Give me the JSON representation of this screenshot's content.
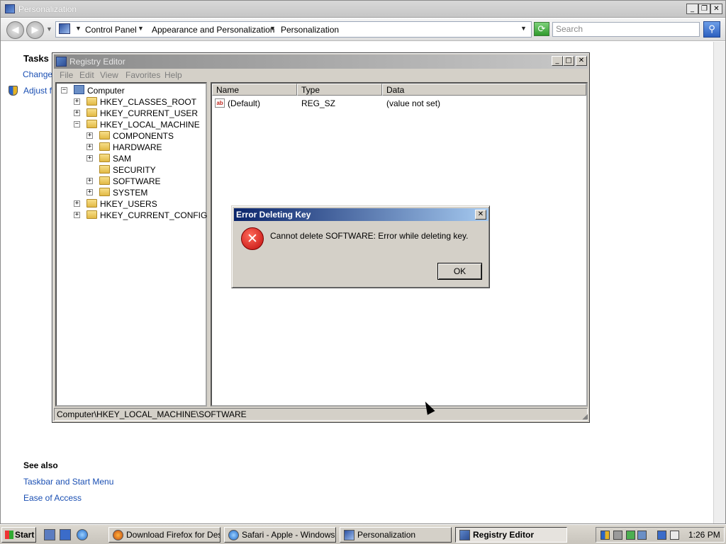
{
  "personalization": {
    "title": "Personalization",
    "breadcrumbs": [
      "Control Panel",
      "Appearance and Personalization",
      "Personalization"
    ],
    "search_placeholder": "Search",
    "tasks_title": "Tasks",
    "task_links": [
      "Change",
      "Adjust fo"
    ],
    "see_also_title": "See also",
    "see_also_links": [
      "Taskbar and Start Menu",
      "Ease of Access"
    ]
  },
  "regedit": {
    "title": "Registry Editor",
    "menu": [
      "File",
      "Edit",
      "View",
      "Favorites",
      "Help"
    ],
    "tree": {
      "root": "Computer",
      "hives": [
        "HKEY_CLASSES_ROOT",
        "HKEY_CURRENT_USER",
        "HKEY_LOCAL_MACHINE",
        "HKEY_USERS",
        "HKEY_CURRENT_CONFIG"
      ],
      "hklm_children": [
        "COMPONENTS",
        "HARDWARE",
        "SAM",
        "SECURITY",
        "SOFTWARE",
        "SYSTEM"
      ]
    },
    "columns": [
      "Name",
      "Type",
      "Data"
    ],
    "values": [
      {
        "name": "(Default)",
        "type": "REG_SZ",
        "data": "(value not set)"
      }
    ],
    "status": "Computer\\HKEY_LOCAL_MACHINE\\SOFTWARE"
  },
  "error_dialog": {
    "title": "Error Deleting Key",
    "message": "Cannot delete SOFTWARE:  Error while deleting key.",
    "ok_label": "OK"
  },
  "taskbar": {
    "start_label": "Start",
    "tasks": [
      "Download Firefox for Des...",
      "Safari - Apple - Windows I...",
      "Personalization",
      "Registry Editor"
    ],
    "active_task": "Registry Editor",
    "clock": "1:26 PM"
  },
  "colors": {
    "dialog_title_start": "#0a246a",
    "dialog_title_end": "#a6caf0",
    "link": "#1a4fb3",
    "error_red": "#c00d0d"
  }
}
